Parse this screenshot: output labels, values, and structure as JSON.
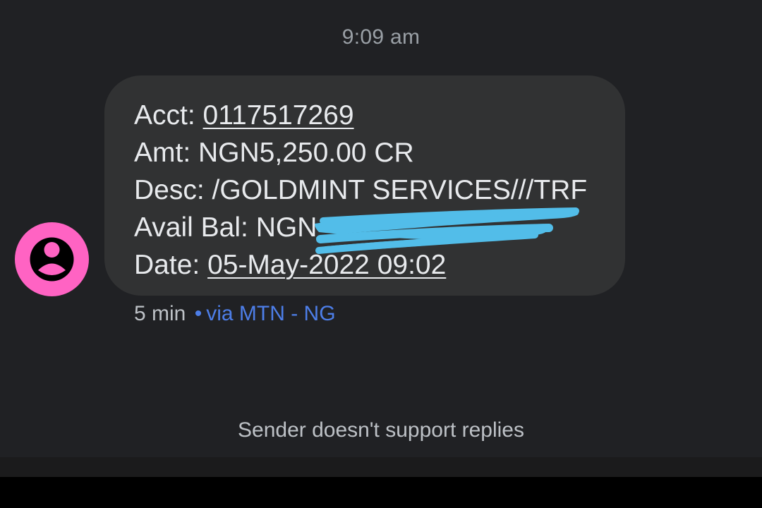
{
  "conversation": {
    "timestamp": "9:09 am",
    "message": {
      "acct_label": "Acct: ",
      "acct_value": "0117517269",
      "amount": "Amt: NGN5,250.00 CR",
      "description": "Desc: /GOLDMINT SERVICES///TRF",
      "balance_label": "Avail Bal: NGN",
      "date_label": "Date: ",
      "date_value": "05-May-2022 09:02"
    },
    "meta": {
      "age": "5 min",
      "separator": "•",
      "via": "via MTN - NG"
    },
    "footer_notice": "Sender doesn't support replies"
  },
  "colors": {
    "background": "#202124",
    "bubble": "#313233",
    "avatar": "#ff63c3",
    "link_blue": "#4d7ee8",
    "redaction": "#52bde9"
  },
  "icons": {
    "avatar": "person-icon",
    "redaction": "redaction-scribble"
  }
}
